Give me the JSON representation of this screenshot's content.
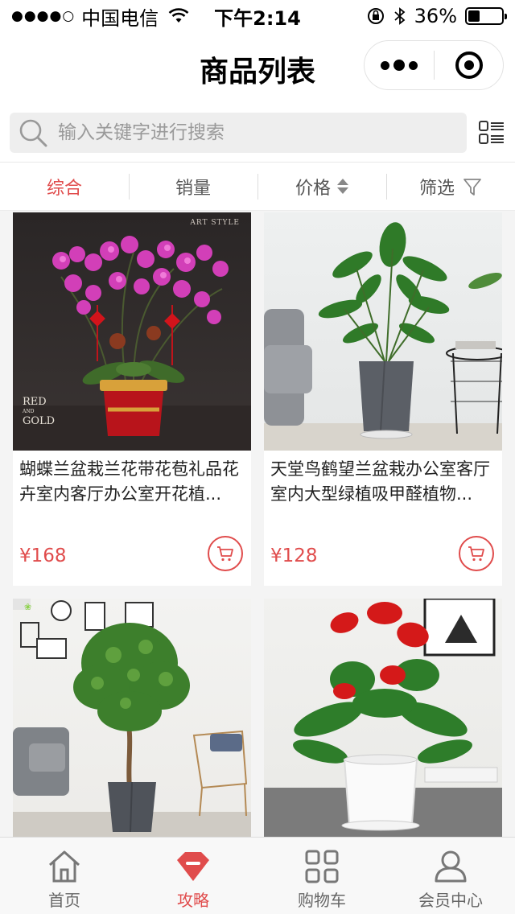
{
  "status_bar": {
    "signal": "●●●●○",
    "carrier": "中国电信",
    "time": "下午2:14",
    "battery_text": "36%",
    "battery_level": 0.36
  },
  "nav": {
    "title": "商品列表"
  },
  "search": {
    "placeholder": "输入关键字进行搜索"
  },
  "filters": {
    "tabs": [
      "综合",
      "销量",
      "价格",
      "筛选"
    ],
    "active_index": 0
  },
  "colors": {
    "accent": "#e04c4c"
  },
  "products": [
    {
      "name": "蝴蝶兰盆栽兰花带花苞礼品花卉室内客厅办公室开花植...",
      "price": "¥168",
      "image_texts": {
        "brand": "ART STYLE",
        "line1": "RED",
        "line2": "AND",
        "line3": "GOLD"
      }
    },
    {
      "name": "天堂鸟鹤望兰盆栽办公室客厅室内大型绿植吸甲醛植物...",
      "price": "¥128"
    },
    {
      "name": "",
      "price": ""
    },
    {
      "name": "",
      "price": ""
    }
  ],
  "tabbar": {
    "items": [
      {
        "label": "首页",
        "icon": "home-icon"
      },
      {
        "label": "攻略",
        "icon": "guide-icon"
      },
      {
        "label": "购物车",
        "icon": "grid-icon"
      },
      {
        "label": "会员中心",
        "icon": "user-icon"
      }
    ],
    "active_index": 1
  }
}
